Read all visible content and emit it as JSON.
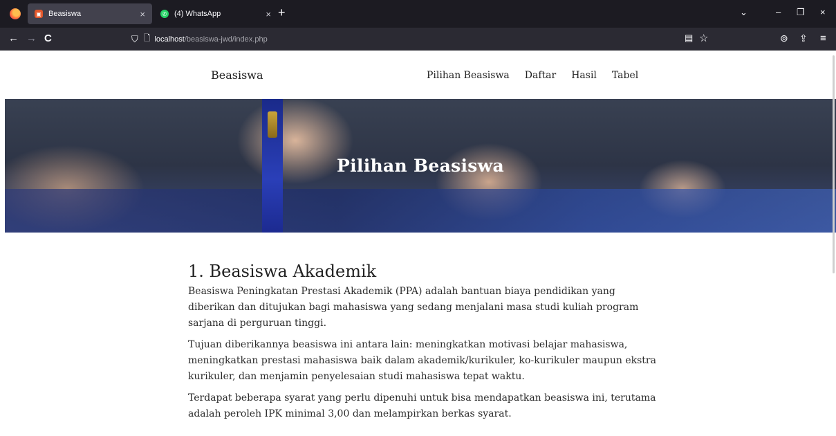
{
  "browser": {
    "tabs": [
      {
        "title": "Beasiswa",
        "close": "×"
      },
      {
        "title": "(4) WhatsApp",
        "close": "×"
      }
    ],
    "new_tab": "+",
    "window_controls": {
      "dropdown": "⌄",
      "minimize": "–",
      "restore": "❐",
      "close": "×"
    },
    "nav": {
      "back": "←",
      "forward": "→",
      "reload": "C"
    },
    "url": {
      "host": "localhost",
      "path": "/beasiswa-jwd/index.php"
    },
    "icons": {
      "shield": "⛉",
      "page": "🗋",
      "reader": "▤",
      "star": "☆",
      "pocket": "⊚",
      "share": "⇪",
      "menu": "≡"
    }
  },
  "site": {
    "brand": "Beasiswa",
    "nav": [
      "Pilihan Beasiswa",
      "Daftar",
      "Hasil",
      "Tabel"
    ]
  },
  "hero": {
    "title": "Pilihan Beasiswa"
  },
  "content": {
    "heading": "1. Beasiswa Akademik",
    "paragraphs": [
      "Beasiswa Peningkatan Prestasi Akademik (PPA) adalah bantuan biaya pendidikan yang diberikan dan ditujukan bagi mahasiswa yang sedang menjalani masa studi kuliah program sarjana di perguruan tinggi.",
      "Tujuan diberikannya beasiswa ini antara lain: meningkatkan motivasi belajar mahasiswa, meningkatkan prestasi mahasiswa baik dalam akademik/kurikuler, ko-kurikuler maupun ekstra kurikuler, dan menjamin penyelesaian studi mahasiswa tepat waktu.",
      "Terdapat beberapa syarat yang perlu dipenuhi untuk bisa mendapatkan beasiswa ini, terutama adalah peroleh IPK minimal 3,00 dan melampirkan berkas syarat."
    ]
  },
  "colors": {
    "tabbar": "#1c1b22",
    "toolbar": "#2b2a33",
    "active_tab": "#42414d",
    "hero_text": "#ffffff"
  }
}
